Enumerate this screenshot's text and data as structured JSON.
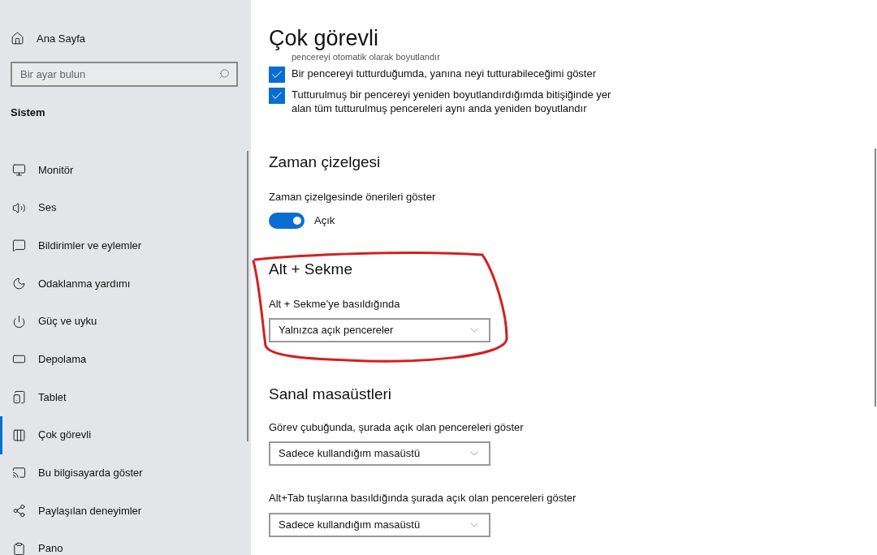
{
  "sidebar": {
    "home": "Ana Sayfa",
    "search": {
      "placeholder": "Bir ayar bulun"
    },
    "section": "Sistem",
    "items": [
      {
        "label": "Monitör",
        "selected": false
      },
      {
        "label": "Ses",
        "selected": false
      },
      {
        "label": "Bildirimler ve eylemler",
        "selected": false
      },
      {
        "label": "Odaklanma yardımı",
        "selected": false
      },
      {
        "label": "Güç ve uyku",
        "selected": false
      },
      {
        "label": "Depolama",
        "selected": false
      },
      {
        "label": "Tablet",
        "selected": false
      },
      {
        "label": "Çok görevli",
        "selected": true
      },
      {
        "label": "Bu bilgisayarda göster",
        "selected": false
      },
      {
        "label": "Paylaşılan deneyimler",
        "selected": false
      },
      {
        "label": "Pano",
        "selected": false
      }
    ]
  },
  "page": {
    "title": "Çok görevli",
    "snap_tail": "pencereyi otomatik olarak boyutlandır",
    "snap_options": [
      {
        "label": "Bir pencereyi tutturduğumda, yanına neyi tutturabileceğimi göster",
        "checked": true
      },
      {
        "label": "Tutturulmuş bir pencereyi yeniden boyutlandırdığımda bitişiğinde yer alan tüm tutturulmuş pencereleri aynı anda yeniden boyutlandır",
        "checked": true
      }
    ],
    "timeline": {
      "heading": "Zaman çizelgesi",
      "label": "Zaman çizelgesinde önerileri göster",
      "on": true,
      "state_text": "Açık"
    },
    "alt_tab": {
      "heading": "Alt + Sekme",
      "label": "Alt + Sekme’ye basıldığında",
      "value": "Yalnızca açık pencereler"
    },
    "virtual_desktops": {
      "heading": "Sanal masaüstleri",
      "settings": [
        {
          "label": "Görev çubuğunda, şurada açık olan pencereleri göster",
          "value": "Sadece kullandığım masaüstü"
        },
        {
          "label": "Alt+Tab tuşlarına basıldığında şurada açık olan pencereleri göster",
          "value": "Sadece kullandığım masaüstü"
        }
      ]
    }
  }
}
